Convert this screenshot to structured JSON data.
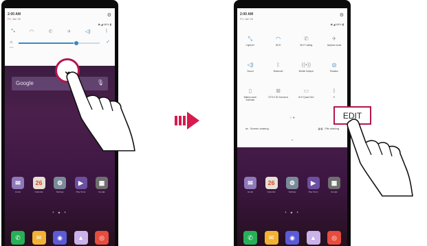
{
  "left_phone": {
    "status": {
      "time": "2:00 AM",
      "date": "Fri, Jan 26",
      "system_icons": "◙ ◢ 68% ▮"
    },
    "quick_icons": [
      "expand",
      "wifi",
      "wifi-calling",
      "airplane",
      "sound",
      "bluetooth"
    ],
    "brightness": {
      "level": 0.7,
      "auto_label": "auto"
    },
    "expand_button": "⌄",
    "google_bar": {
      "logo": "Google"
    },
    "apps_row1": [
      {
        "label": "Email",
        "color": "#8e79b8",
        "glyph": "✉"
      },
      {
        "label": "Calendar",
        "color": "#e7e0d3",
        "glyph": "26"
      },
      {
        "label": "Settings",
        "color": "#7a8a99",
        "glyph": "⚙"
      },
      {
        "label": "Play Store",
        "color": "#6b4fa0",
        "glyph": "▶"
      },
      {
        "label": "Google",
        "color": "#6f6f6f",
        "glyph": "▦"
      }
    ],
    "dock": [
      {
        "name": "phone",
        "color": "#27b057",
        "glyph": "✆"
      },
      {
        "name": "messages",
        "color": "#f2b233",
        "glyph": "✉"
      },
      {
        "name": "browser",
        "color": "#5b5bd6",
        "glyph": "◉"
      },
      {
        "name": "gallery",
        "color": "#c9b3e8",
        "glyph": "▲"
      },
      {
        "name": "chrome",
        "color": "#e74c3c",
        "glyph": "◎"
      }
    ]
  },
  "right_phone": {
    "status": {
      "time": "2:00 AM",
      "date": "Fri, Jan 26",
      "system_icons": "◙ ◢ 68% ▮"
    },
    "tile_rows": [
      [
        {
          "icon": "expand",
          "label": "Capture+",
          "active": true
        },
        {
          "icon": "wifi",
          "label": "Wi-Fi",
          "active": true
        },
        {
          "icon": "wifi-calling",
          "label": "Wi-Fi Calling",
          "active": false
        },
        {
          "icon": "airplane",
          "label": "Airplane mode",
          "active": false
        }
      ],
      [
        {
          "icon": "sound",
          "label": "Sound",
          "active": true
        },
        {
          "icon": "bluetooth",
          "label": "Bluetooth",
          "active": false
        },
        {
          "icon": "hotspot",
          "label": "Mobile Hotspot",
          "active": false
        },
        {
          "icon": "rotation",
          "label": "Rotation",
          "active": true
        }
      ],
      [
        {
          "icon": "battery",
          "label": "Battery saver Extender",
          "active": false
        },
        {
          "icon": "nfc",
          "label": "DTS:X 3D Surround",
          "active": false
        },
        {
          "icon": "quad",
          "label": "Hi-Fi Quad DAC",
          "active": false
        },
        {
          "icon": "bluetooth-off",
          "label": "E",
          "active": false
        }
      ]
    ],
    "page_dots": "○ ●",
    "screen_sharing": "Screen sharing",
    "file_sharing": "File sharing",
    "edit_label": "EDIT",
    "apps_row1": [
      {
        "label": "Email",
        "color": "#8e79b8",
        "glyph": "✉"
      },
      {
        "label": "Calendar",
        "color": "#e7e0d3",
        "glyph": "26"
      },
      {
        "label": "Settings",
        "color": "#7a8a99",
        "glyph": "⚙"
      },
      {
        "label": "Play Store",
        "color": "#6b4fa0",
        "glyph": "▶"
      },
      {
        "label": "Google",
        "color": "#6f6f6f",
        "glyph": "▦"
      }
    ],
    "dock": [
      {
        "name": "phone",
        "color": "#27b057",
        "glyph": "✆"
      },
      {
        "name": "messages",
        "color": "#f2b233",
        "glyph": "✉"
      },
      {
        "name": "browser",
        "color": "#5b5bd6",
        "glyph": "◉"
      },
      {
        "name": "gallery",
        "color": "#c9b3e8",
        "glyph": "▲"
      },
      {
        "name": "chrome",
        "color": "#e74c3c",
        "glyph": "◎"
      }
    ]
  },
  "arrow_color": "#d81a4f",
  "highlight_color": "#b3154f"
}
